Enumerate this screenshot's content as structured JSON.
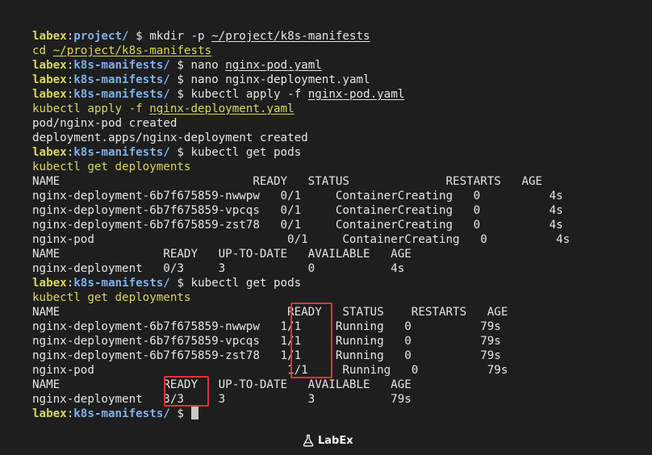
{
  "prompt": {
    "user": "labex",
    "sep": ":",
    "dollar": " $ "
  },
  "terminal_lines": [
    {
      "kind": "prompt",
      "dir": "project/",
      "cmd_plain": "mkdir -p ",
      "cmd_u": "~/project/k8s-manifests"
    },
    {
      "kind": "echo",
      "plain": "cd ",
      "u": "~/project/k8s-manifests"
    },
    {
      "kind": "prompt",
      "dir": "k8s-manifests/",
      "cmd_plain": "nano ",
      "cmd_u": "nginx-pod.yaml"
    },
    {
      "kind": "prompt",
      "dir": "k8s-manifests/",
      "cmd_plain": "nano nginx-deployment.yaml",
      "cmd_u": ""
    },
    {
      "kind": "prompt",
      "dir": "k8s-manifests/",
      "cmd_plain": "kubectl apply -f ",
      "cmd_u": "nginx-pod.yaml"
    },
    {
      "kind": "echo",
      "plain": "kubectl apply -f ",
      "u": "nginx-deployment.yaml"
    },
    {
      "kind": "out",
      "text": "pod/nginx-pod created"
    },
    {
      "kind": "out",
      "text": "deployment.apps/nginx-deployment created"
    },
    {
      "kind": "prompt",
      "dir": "k8s-manifests/",
      "cmd_plain": "kubectl get pods",
      "cmd_u": ""
    },
    {
      "kind": "echo",
      "plain": "kubectl get deployments",
      "u": ""
    },
    {
      "kind": "out",
      "text": "NAME                            READY   STATUS              RESTARTS   AGE"
    },
    {
      "kind": "out",
      "text": "nginx-deployment-6b7f675859-nwwpw   0/1     ContainerCreating   0          4s"
    },
    {
      "kind": "out",
      "text": "nginx-deployment-6b7f675859-vpcqs   0/1     ContainerCreating   0          4s"
    },
    {
      "kind": "out",
      "text": "nginx-deployment-6b7f675859-zst78   0/1     ContainerCreating   0          4s"
    },
    {
      "kind": "out",
      "text": "nginx-pod                            0/1     ContainerCreating   0          4s"
    },
    {
      "kind": "out",
      "text": "NAME               READY   UP-TO-DATE   AVAILABLE   AGE"
    },
    {
      "kind": "out",
      "text": "nginx-deployment   0/3     3            0           4s"
    },
    {
      "kind": "prompt",
      "dir": "k8s-manifests/",
      "cmd_plain": "kubectl get pods",
      "cmd_u": ""
    },
    {
      "kind": "echo",
      "plain": "kubectl get deployments",
      "u": ""
    },
    {
      "kind": "out",
      "text": "NAME                                 READY   STATUS    RESTARTS   AGE"
    },
    {
      "kind": "out",
      "text": "nginx-deployment-6b7f675859-nwwpw   1/1     Running   0          79s"
    },
    {
      "kind": "out",
      "text": "nginx-deployment-6b7f675859-vpcqs   1/1     Running   0          79s"
    },
    {
      "kind": "out",
      "text": "nginx-deployment-6b7f675859-zst78   1/1     Running   0          79s"
    },
    {
      "kind": "out",
      "text": "nginx-pod                            1/1     Running   0          79s"
    },
    {
      "kind": "out",
      "text": "NAME               READY   UP-TO-DATE   AVAILABLE   AGE"
    },
    {
      "kind": "out",
      "text": "nginx-deployment   3/3     3            3           79s"
    },
    {
      "kind": "prompt",
      "dir": "k8s-manifests/",
      "cmd_plain": "",
      "cmd_u": "",
      "cursor": true
    }
  ],
  "highlights": [
    {
      "label": "pods-ready-column"
    },
    {
      "label": "deployment-ready-value"
    }
  ],
  "logo": {
    "text": "LabEx",
    "icon": "flask-icon"
  },
  "colors": {
    "background": "#1e1e1e",
    "user": "#d7d75f",
    "path": "#7fb0e6",
    "text": "#e6e6e6",
    "highlight": "#e0323c"
  }
}
